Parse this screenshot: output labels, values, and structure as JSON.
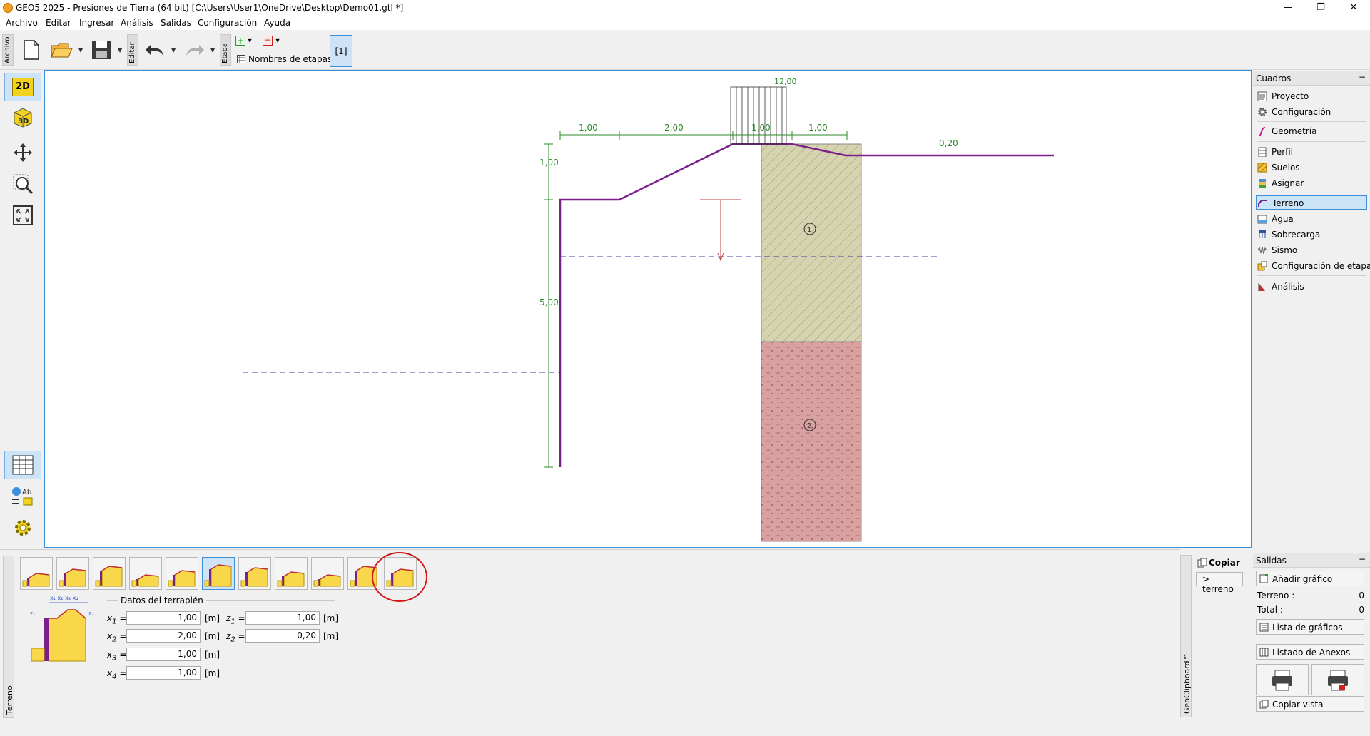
{
  "window": {
    "title": "GEO5 2025 - Presiones de Tierra (64 bit) [C:\\Users\\User1\\OneDrive\\Desktop\\Demo01.gtl *]",
    "minimize": "—",
    "restore": "❐",
    "close": "✕"
  },
  "menu": [
    "Archivo",
    "Editar",
    "Ingresar",
    "Análisis",
    "Salidas",
    "Configuración",
    "Ayuda"
  ],
  "toolbar": {
    "file_group": "Archivo",
    "edit_group": "Editar",
    "stage_group": "Etapa",
    "stage_names_label": "Nombres de etapas",
    "current_stage": "[1]"
  },
  "left_tools": {
    "view_2d": "2D",
    "view_3d": "3D",
    "legend_ab": "Ab"
  },
  "drawing": {
    "dims_top": [
      "1,00",
      "2,00",
      "1,00",
      "1,00"
    ],
    "dim_right": "0,20",
    "dim_surcharge": "12,00",
    "dim_left_top": "1,00",
    "dim_left_height": "5,00",
    "soil_labels": [
      "1",
      "2"
    ]
  },
  "right_panel": {
    "header": "Cuadros",
    "minimize": "−",
    "items": [
      {
        "label": "Proyecto",
        "icon": "document-icon"
      },
      {
        "label": "Configuración",
        "icon": "gear-icon"
      },
      {
        "label": "Geometría",
        "icon": "geometry-icon"
      },
      {
        "label": "Perfil",
        "icon": "profile-icon"
      },
      {
        "label": "Suelos",
        "icon": "soils-icon"
      },
      {
        "label": "Asignar",
        "icon": "assign-icon"
      },
      {
        "label": "Terreno",
        "icon": "terrain-icon"
      },
      {
        "label": "Agua",
        "icon": "water-icon"
      },
      {
        "label": "Sobrecarga",
        "icon": "surcharge-icon"
      },
      {
        "label": "Sismo",
        "icon": "earthquake-icon"
      },
      {
        "label": "Configuración de etapa",
        "icon": "stage-settings-icon"
      },
      {
        "label": "Análisis",
        "icon": "analysis-icon"
      }
    ],
    "selected": "Terreno"
  },
  "bottom": {
    "side_label": "Terreno",
    "group_title": "Datos del terraplén",
    "fields": [
      {
        "name": "x1",
        "sym": "x",
        "sub": "1",
        "value": "1,00",
        "unit": "[m]"
      },
      {
        "name": "x2",
        "sym": "x",
        "sub": "2",
        "value": "2,00",
        "unit": "[m]"
      },
      {
        "name": "x3",
        "sym": "x",
        "sub": "3",
        "value": "1,00",
        "unit": "[m]"
      },
      {
        "name": "x4",
        "sym": "x",
        "sub": "4",
        "value": "1,00",
        "unit": "[m]"
      },
      {
        "name": "z1",
        "sym": "z",
        "sub": "1",
        "value": "1,00",
        "unit": "[m]"
      },
      {
        "name": "z2",
        "sym": "z",
        "sub": "2",
        "value": "0,20",
        "unit": "[m]"
      }
    ],
    "eq": "=",
    "shape_count": 11,
    "selected_shape": 6
  },
  "clipboard": {
    "side_label": "GeoClipboard™",
    "copy_label": "Copiar",
    "terrain_label": "> terreno"
  },
  "outputs": {
    "header": "Salidas",
    "minimize": "−",
    "add_chart": "Añadir gráfico",
    "terrain_label": "Terreno :",
    "terrain_count": "0",
    "total_label": "Total :",
    "total_count": "0",
    "chart_list": "Lista de gráficos",
    "annex_list": "Listado de Anexos",
    "copy_view": "Copiar vista"
  },
  "colors": {
    "accent": "#3c8fd8",
    "terrain_line": "#7b1f8a",
    "dimension": "#2a8a2a",
    "soil1": "#d6d3b0",
    "soil2": "#d9a0a0",
    "highlight_circle": "#d01818"
  }
}
